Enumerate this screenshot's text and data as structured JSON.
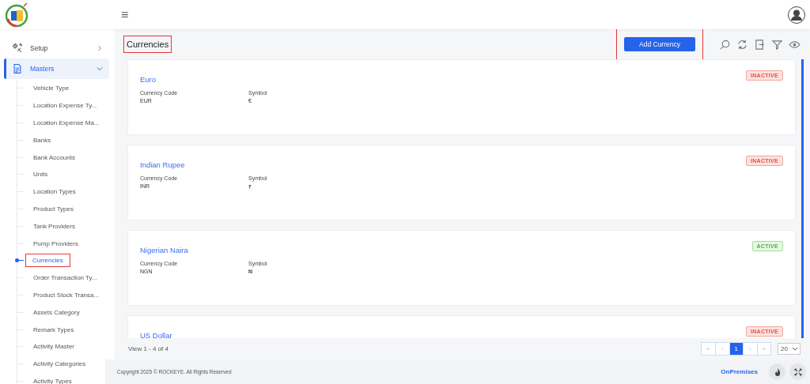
{
  "header": {
    "menu_glyph": "≡"
  },
  "sidebar": {
    "items": [
      {
        "label": "Setup",
        "expanded": false,
        "selected": false
      },
      {
        "label": "Masters",
        "expanded": true,
        "selected": true,
        "children": [
          {
            "label": "Vehicle Type",
            "selected": false,
            "highlighted": false
          },
          {
            "label": "Location Expense Ty...",
            "selected": false,
            "highlighted": false
          },
          {
            "label": "Location Expense Ma...",
            "selected": false,
            "highlighted": false
          },
          {
            "label": "Banks",
            "selected": false,
            "highlighted": false
          },
          {
            "label": "Bank Accounts",
            "selected": false,
            "highlighted": false
          },
          {
            "label": "Units",
            "selected": false,
            "highlighted": false
          },
          {
            "label": "Location Types",
            "selected": false,
            "highlighted": false
          },
          {
            "label": "Product Types",
            "selected": false,
            "highlighted": false
          },
          {
            "label": "Tank Providers",
            "selected": false,
            "highlighted": false
          },
          {
            "label": "Pump Providers",
            "selected": false,
            "highlighted": false
          },
          {
            "label": "Currencies",
            "selected": true,
            "highlighted": true
          },
          {
            "label": "Order Transaction Ty...",
            "selected": false,
            "highlighted": false
          },
          {
            "label": "Product Stock Transa...",
            "selected": false,
            "highlighted": false
          },
          {
            "label": "Assets Category",
            "selected": false,
            "highlighted": false
          },
          {
            "label": "Remark Types",
            "selected": false,
            "highlighted": false
          },
          {
            "label": "Activity Master",
            "selected": false,
            "highlighted": false
          },
          {
            "label": "Activity Categories",
            "selected": false,
            "highlighted": false
          },
          {
            "label": "Activity Types",
            "selected": false,
            "highlighted": false
          }
        ]
      }
    ]
  },
  "page": {
    "title": "Currencies",
    "title_highlighted": true,
    "add_button": "Add Currency",
    "add_button_highlighted": true
  },
  "currencies": [
    {
      "name": "Euro",
      "code_label": "Currency Code",
      "code": "EUR",
      "symbol_label": "Symbol",
      "symbol": "€",
      "status": "INACTIVE",
      "active": false
    },
    {
      "name": "Indian Rupee",
      "code_label": "Currency Code",
      "code": "INR",
      "symbol_label": "Symbol",
      "symbol": "₹",
      "status": "INACTIVE",
      "active": false
    },
    {
      "name": "Nigerian Naira",
      "code_label": "Currency Code",
      "code": "NGN",
      "symbol_label": "Symbol",
      "symbol": "₦",
      "status": "ACTIVE",
      "active": true
    },
    {
      "name": "US Dollar",
      "status": "INACTIVE",
      "active": false
    }
  ],
  "pager": {
    "summary": "View 1 - 4 of 4",
    "buttons": [
      {
        "label": "«",
        "selected": false,
        "disabled": true
      },
      {
        "label": "‹",
        "selected": false,
        "disabled": true
      },
      {
        "label": "1",
        "selected": true,
        "disabled": false
      },
      {
        "label": "›",
        "selected": false,
        "disabled": true
      },
      {
        "label": "»",
        "selected": false,
        "disabled": true
      }
    ],
    "page_size": "20"
  },
  "footer": {
    "copyright": "Copyright 2025 © ROCKEYE. All Rights Reserved",
    "mode": "OnPremises"
  }
}
